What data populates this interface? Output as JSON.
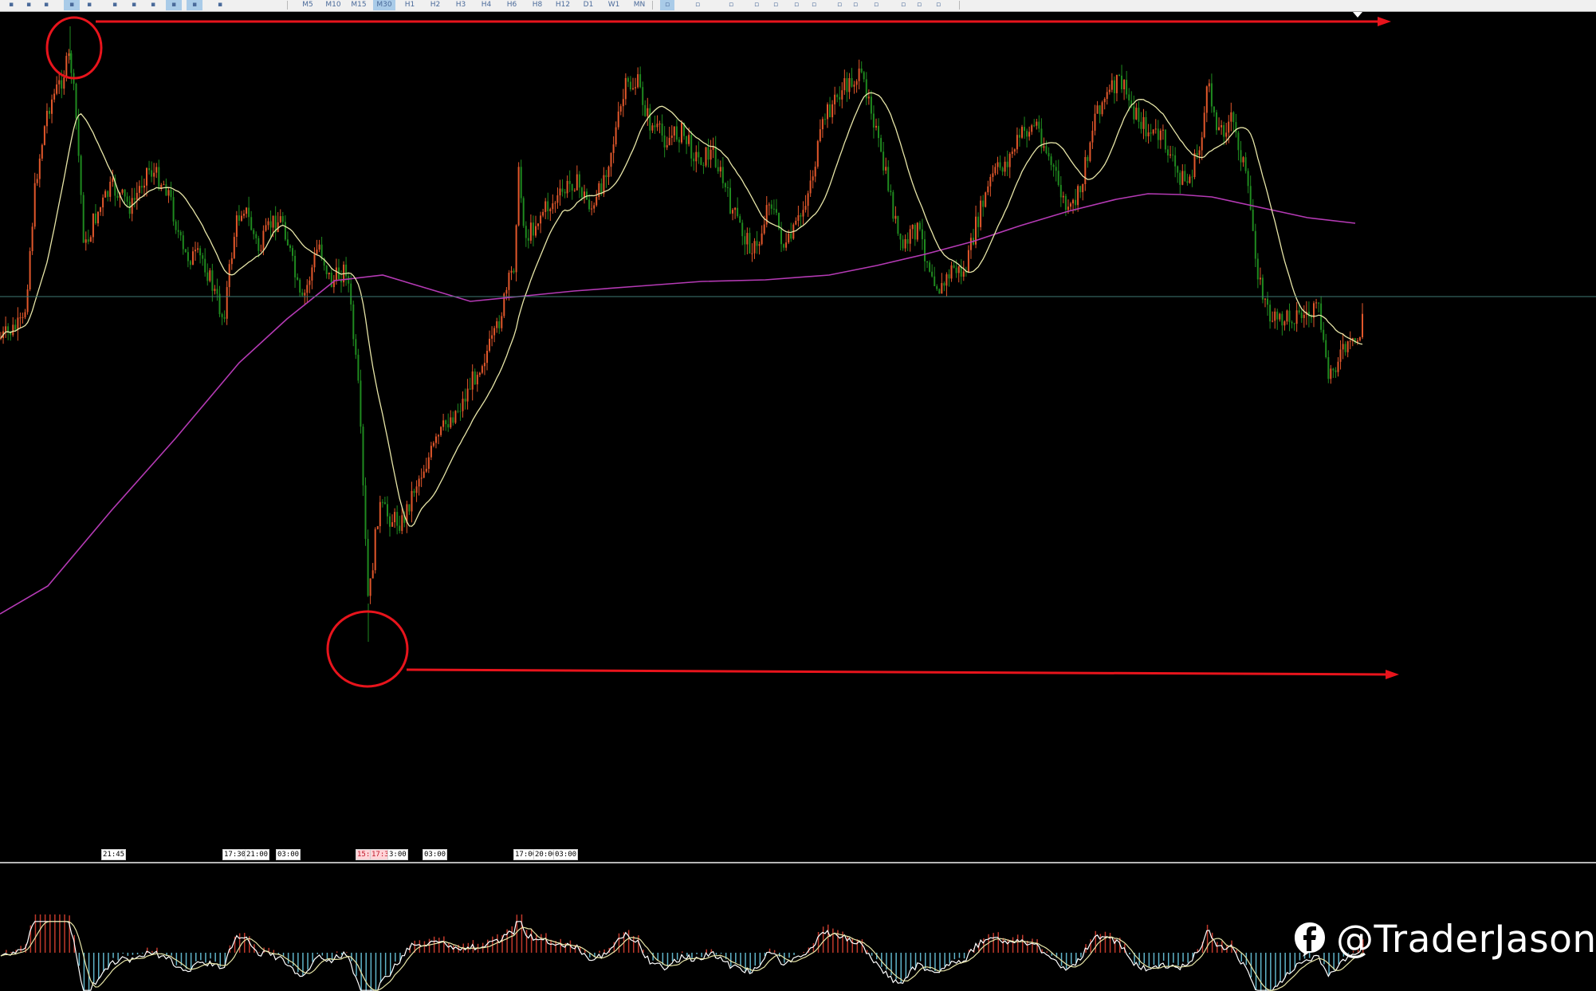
{
  "toolbar": {
    "timeframes": [
      "M5",
      "M10",
      "M15",
      "M30",
      "H1",
      "H2",
      "H3",
      "H4",
      "H6",
      "H8",
      "H12",
      "D1",
      "W1",
      "MN"
    ],
    "active_timeframe": "M30"
  },
  "time_axis": {
    "labels": [
      "21:45",
      "17:30",
      "21:00",
      "03:00",
      "15:",
      "17:30",
      "3:00",
      "03:00",
      "17:00",
      "20:00",
      "03:00"
    ]
  },
  "annotations": {
    "top_line_color": "#e8141c",
    "bottom_line_color": "#e8141c"
  },
  "watermark": {
    "icon": "facebook-icon",
    "text": "@TraderJason"
  },
  "colors": {
    "background": "#000000",
    "bull_candle": "#e2572b",
    "bear_candle": "#1f8a1f",
    "ma_fast": "#e8e6a8",
    "ma_slow": "#b53ab5",
    "crosshair": "#3f7a74",
    "osc_positive": "#c0392b",
    "osc_negative": "#5fb3c9"
  }
}
